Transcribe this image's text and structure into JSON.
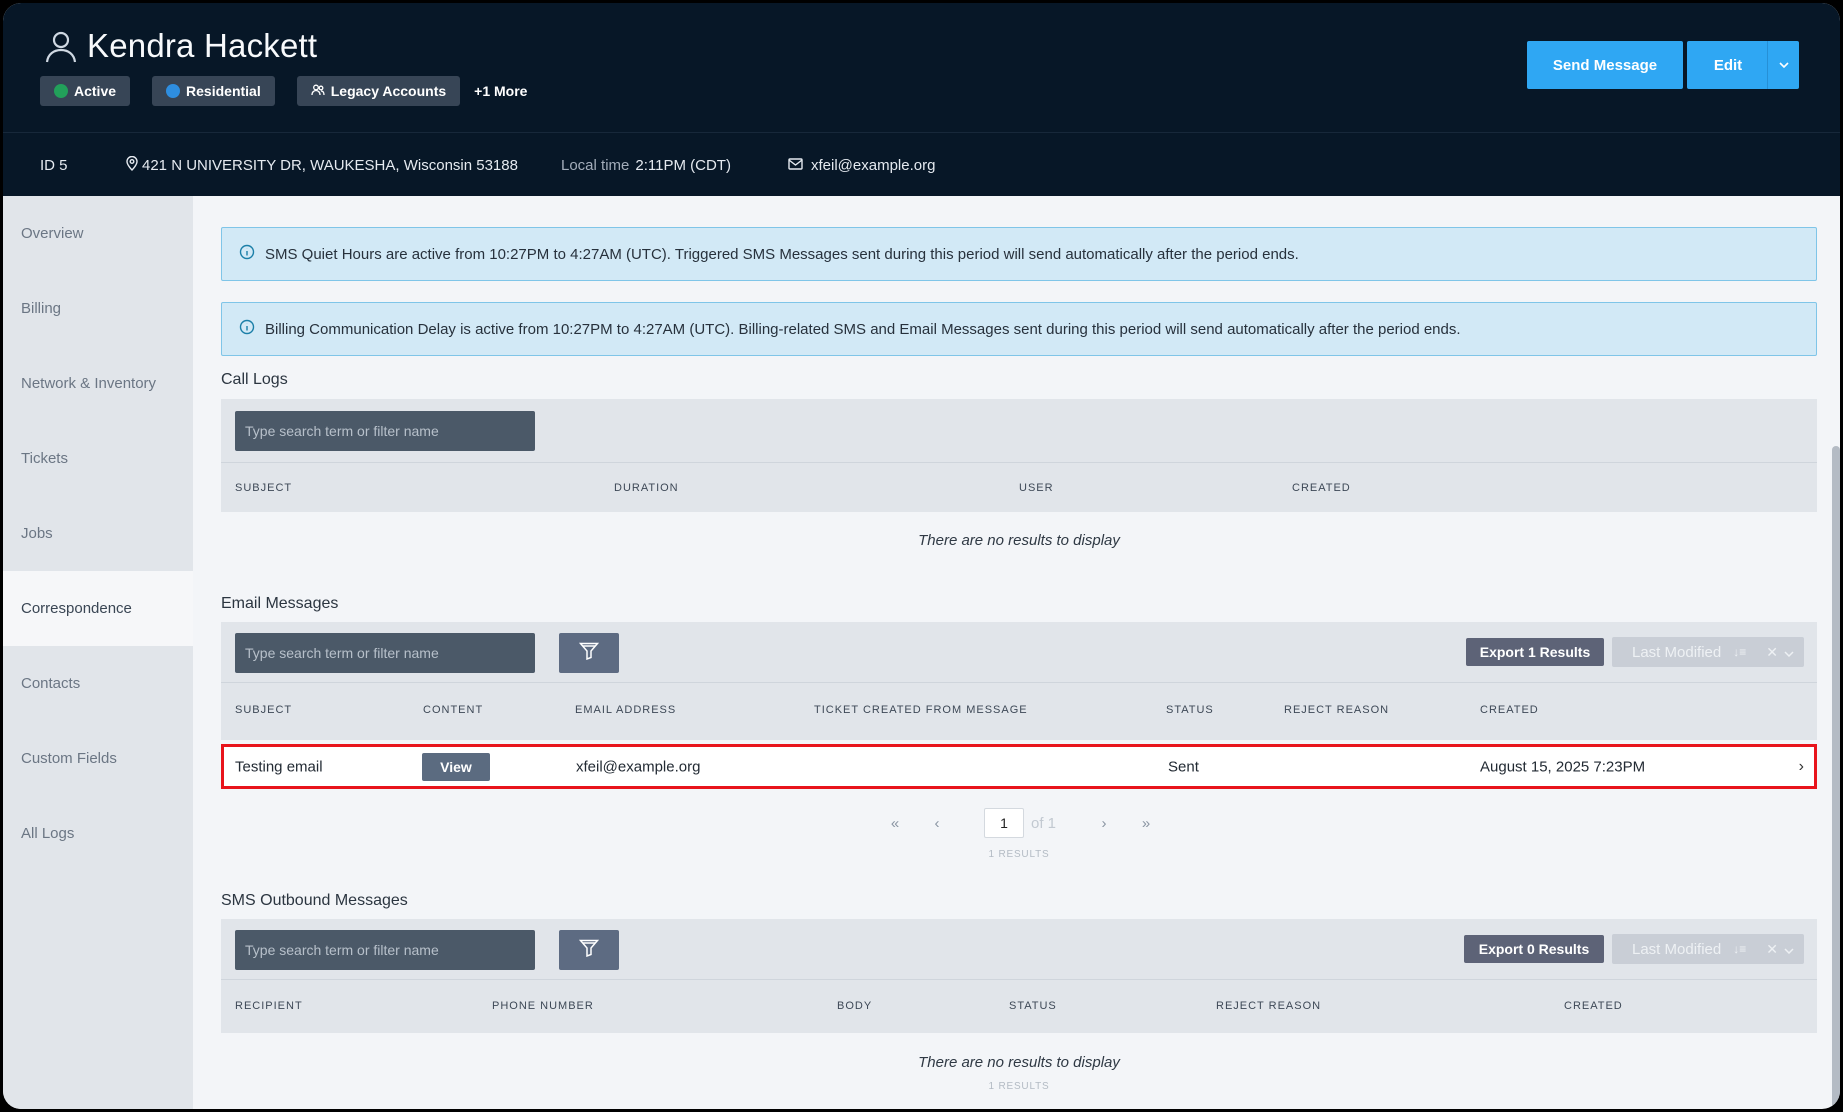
{
  "customer": {
    "name": "Kendra Hackett",
    "tags": [
      {
        "label": "Active",
        "color": "#22a05a"
      },
      {
        "label": "Residential",
        "color": "#2e8ee0"
      },
      {
        "label": "Legacy Accounts",
        "icon": "users-icon"
      }
    ],
    "more_tags": "+1 More",
    "id_text": "ID 5",
    "address": "421 N UNIVERSITY DR, WAUKESHA, Wisconsin 53188",
    "local_time_label": "Local time",
    "local_time": "2:11PM (CDT)",
    "email": "xfeil@example.org"
  },
  "actions": {
    "send_message": "Send Message",
    "edit": "Edit"
  },
  "sidebar": {
    "items": [
      {
        "label": "Overview"
      },
      {
        "label": "Billing"
      },
      {
        "label": "Network & Inventory"
      },
      {
        "label": "Tickets"
      },
      {
        "label": "Jobs"
      },
      {
        "label": "Correspondence",
        "active": true
      },
      {
        "label": "Contacts"
      },
      {
        "label": "Custom Fields"
      },
      {
        "label": "All Logs"
      }
    ]
  },
  "alerts": [
    "SMS Quiet Hours are active from 10:27PM to 4:27AM (UTC). Triggered SMS Messages sent during this period will send automatically after the period ends.",
    "Billing Communication Delay is active from 10:27PM to 4:27AM (UTC). Billing-related SMS and Email Messages sent during this period will send automatically after the period ends."
  ],
  "search_placeholder": "Type search term or filter name",
  "call_logs": {
    "title": "Call Logs",
    "columns": [
      "SUBJECT",
      "DURATION",
      "USER",
      "CREATED"
    ],
    "empty_text": "There are no results to display"
  },
  "email_messages": {
    "title": "Email Messages",
    "export_label": "Export 1 Results",
    "sort_label": "Last Modified",
    "columns": [
      "SUBJECT",
      "CONTENT",
      "EMAIL ADDRESS",
      "TICKET CREATED FROM MESSAGE",
      "STATUS",
      "REJECT REASON",
      "CREATED"
    ],
    "rows": [
      {
        "subject": "Testing email",
        "content_button": "View",
        "email_address": "xfeil@example.org",
        "ticket_created": "",
        "status": "Sent",
        "reject_reason": "",
        "created": "August 15, 2025 7:23PM"
      }
    ],
    "pagination": {
      "page": "1",
      "of_text": "of 1",
      "results_text": "1 RESULTS"
    }
  },
  "sms_outbound": {
    "title": "SMS Outbound Messages",
    "export_label": "Export 0 Results",
    "sort_label": "Last Modified",
    "columns": [
      "RECIPIENT",
      "PHONE NUMBER",
      "BODY",
      "STATUS",
      "REJECT REASON",
      "CREATED"
    ],
    "empty_text": "There are no results to display",
    "results_text": "1 RESULTS"
  }
}
